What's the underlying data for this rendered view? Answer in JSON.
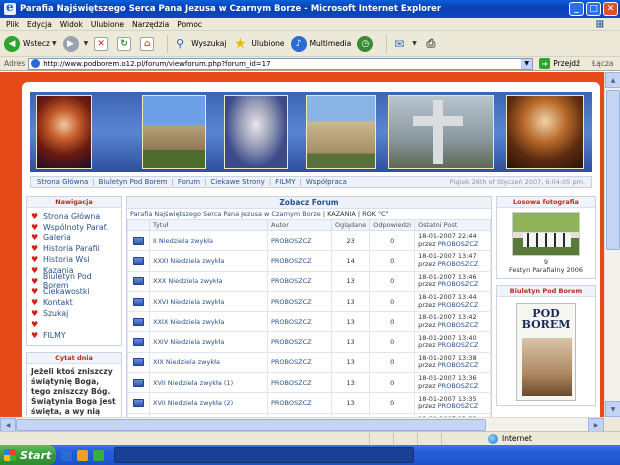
{
  "window": {
    "title": "Parafia Najświętszego Serca Pana Jezusa w Czarnym Borze - Microsoft Internet Explorer",
    "min_label": "_",
    "max_label": "□",
    "close_label": "✕"
  },
  "menu": [
    "Plik",
    "Edycja",
    "Widok",
    "Ulubione",
    "Narzędzia",
    "Pomoc"
  ],
  "toolbar": {
    "back_label": "Wstecz",
    "search_label": "Wyszukaj",
    "favorites_label": "Ulubione",
    "media_label": "Multimedia"
  },
  "address": {
    "label": "Adres",
    "url": "http://www.podborem.o12.pl/forum/viewforum.php?forum_id=17",
    "go_label": "Przejdź",
    "links_label": "Łącza"
  },
  "site_nav": {
    "links": [
      "Strona Główna",
      "Biuletyn Pod Borem",
      "Forum",
      "Ciekawe Strony",
      "FILMY",
      "Współpraca"
    ],
    "date": "Piątek 26th of Styczeń 2007, 6:04:05 pm."
  },
  "left_nav": {
    "heading": "Nawigacja",
    "items": [
      "Strona Główna",
      "Wspólnoty Paraf.",
      "Galeria",
      "Historia Parafii",
      "Historia Wsi",
      "Kazania",
      "Biuletyn Pod Borem",
      "Ciekawostki",
      "Kontakt",
      "Szukaj",
      "",
      "FILMY"
    ]
  },
  "quote_box": {
    "heading": "Cytat dnia",
    "text": "Jeżeli ktoś zniszczy świątynię Boga, tego zniszczy Bóg. Świątynia Boga jest święta, a wy nią jesteście."
  },
  "forum": {
    "heading": "Zobacz Forum",
    "breadcrumb_link": "Parafia Najświętszego Serca Pana Jezusa w Czarnym Borze",
    "breadcrumb_rest": " | KAZANIA | ROK \"C\"",
    "columns": [
      "Tytuł",
      "Autor",
      "Oglądane",
      "Odpowiedzi",
      "Ostatni Post"
    ],
    "topics": [
      {
        "title": "II Niedziela zwykła",
        "author": "PROBOSZCZ",
        "views": "23",
        "replies": "0",
        "last_date": "18-01-2007 22:44",
        "last_by": "PROBOSZCZ"
      },
      {
        "title": "XXXI Niedziela zwykła",
        "author": "PROBOSZCZ",
        "views": "14",
        "replies": "0",
        "last_date": "18-01-2007 13:47",
        "last_by": "PROBOSZCZ"
      },
      {
        "title": "XXX Niedziela zwykła",
        "author": "PROBOSZCZ",
        "views": "13",
        "replies": "0",
        "last_date": "18-01-2007 13:46",
        "last_by": "PROBOSZCZ"
      },
      {
        "title": "XXVI Niedziela zwykła",
        "author": "PROBOSZCZ",
        "views": "13",
        "replies": "0",
        "last_date": "18-01-2007 13:44",
        "last_by": "PROBOSZCZ"
      },
      {
        "title": "XXIX Niedziela zwykła",
        "author": "PROBOSZCZ",
        "views": "13",
        "replies": "0",
        "last_date": "18-01-2007 13:42",
        "last_by": "PROBOSZCZ"
      },
      {
        "title": "XXIV Niedziela zwykła",
        "author": "PROBOSZCZ",
        "views": "13",
        "replies": "0",
        "last_date": "18-01-2007 13:40",
        "last_by": "PROBOSZCZ"
      },
      {
        "title": "XIX Niedziela zwykła",
        "author": "PROBOSZCZ",
        "views": "13",
        "replies": "0",
        "last_date": "18-01-2007 13:38",
        "last_by": "PROBOSZCZ"
      },
      {
        "title": "XVII Niedziela zwykła (1)",
        "author": "PROBOSZCZ",
        "views": "13",
        "replies": "0",
        "last_date": "18-01-2007 13:36",
        "last_by": "PROBOSZCZ"
      },
      {
        "title": "XVII Niedziela zwykła (2)",
        "author": "PROBOSZCZ",
        "views": "13",
        "replies": "0",
        "last_date": "18-01-2007 13:35",
        "last_by": "PROBOSZCZ"
      },
      {
        "title": "XV Niedziela zwykła",
        "author": "PROBOSZCZ",
        "views": "13",
        "replies": "0",
        "last_date": "18-01-2007 13:33",
        "last_by": "PROBOSZCZ"
      }
    ],
    "by_prefix": "przez "
  },
  "random_photo": {
    "heading": "Losowa fotografia",
    "caption_num": "9",
    "caption": "Festyn Parafialny 2006"
  },
  "bulletin": {
    "heading": "Biuletyn Pod Borem",
    "title_line1": "POD",
    "title_line2": "BOREM"
  },
  "status": {
    "zone": "Internet"
  },
  "taskbar": {
    "start_label": "Start"
  }
}
